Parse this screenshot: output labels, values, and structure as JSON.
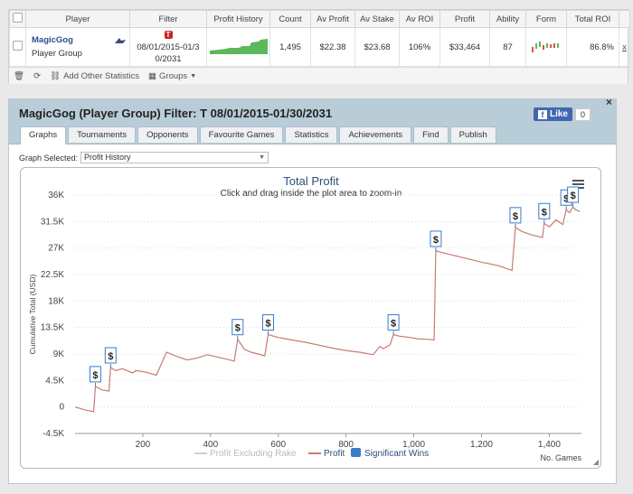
{
  "table": {
    "headers": [
      "Player",
      "Filter",
      "Profit History",
      "Count",
      "Av Profit",
      "Av Stake",
      "Av ROI",
      "Profit",
      "Ability",
      "Form",
      "Total ROI"
    ],
    "row": {
      "player_name": "MagicGog",
      "player_group": "Player Group",
      "filter_icon": "T",
      "filter_text": "08/01/2015-01/30/2031",
      "count": "1,495",
      "av_profit": "$22.38",
      "av_stake": "$23.68",
      "av_roi": "106%",
      "profit": "$33,464",
      "ability": "87",
      "total_roi": "86.8%",
      "remove": "x"
    }
  },
  "toolbar": {
    "add_stats": "Add Other Statistics",
    "groups": "Groups"
  },
  "panel": {
    "title": "MagicGog (Player Group) Filter: T 08/01/2015-01/30/2031",
    "like_label": "Like",
    "like_count": "0",
    "close": "×",
    "tabs": [
      "Graphs",
      "Tournaments",
      "Opponents",
      "Favourite Games",
      "Statistics",
      "Achievements",
      "Find",
      "Publish"
    ],
    "graph_selected_label": "Graph Selected:",
    "graph_selected_value": "Profit History"
  },
  "colors": {
    "profit_line": "#c87a72",
    "rake_line": "#d0d0d0",
    "sig_marker": "#3a7cc7",
    "title": "#2d4f7a"
  },
  "chart_data": {
    "type": "line",
    "title": "Total Profit",
    "subtitle": "Click and drag inside the plot area to zoom-in",
    "ylabel": "Cumulative Total (USD)",
    "xlabel": "No. Games",
    "ylim": [
      -4500,
      36000
    ],
    "xlim": [
      0,
      1495
    ],
    "y_ticks": [
      "-4.5K",
      "0",
      "4.5K",
      "9K",
      "13.5K",
      "18K",
      "22.5K",
      "27K",
      "31.5K",
      "36K"
    ],
    "x_ticks": [
      "200",
      "400",
      "600",
      "800",
      "1,000",
      "1,200",
      "1,400"
    ],
    "legend": [
      "Profit Excluding Rake",
      "Profit",
      "Significant Wins"
    ],
    "legend_position": "bottom",
    "series": [
      {
        "name": "Profit",
        "x": [
          0,
          30,
          55,
          60,
          80,
          100,
          105,
          120,
          140,
          170,
          180,
          210,
          240,
          270,
          300,
          330,
          360,
          390,
          420,
          450,
          470,
          480,
          500,
          520,
          540,
          560,
          570,
          600,
          640,
          680,
          720,
          760,
          800,
          840,
          880,
          900,
          910,
          930,
          940,
          960,
          990,
          1010,
          1040,
          1060,
          1065,
          1100,
          1150,
          1200,
          1250,
          1290,
          1300,
          1320,
          1350,
          1380,
          1385,
          1400,
          1420,
          1440,
          1450,
          1460,
          1470,
          1475,
          1490
        ],
        "y": [
          0,
          -500,
          -800,
          3500,
          2900,
          2700,
          6700,
          6200,
          6500,
          5800,
          6200,
          5900,
          5400,
          9300,
          8600,
          8000,
          8300,
          8900,
          8500,
          8100,
          7800,
          11500,
          9800,
          9300,
          9000,
          8700,
          12300,
          11800,
          11400,
          11000,
          10500,
          10000,
          9600,
          9300,
          8900,
          10300,
          9900,
          10600,
          12300,
          12000,
          11800,
          11600,
          11500,
          11400,
          26500,
          26000,
          25300,
          24600,
          24000,
          23200,
          30500,
          29800,
          29200,
          28800,
          31200,
          30600,
          31800,
          31000,
          33500,
          33000,
          34000,
          33600,
          33200
        ]
      }
    ],
    "significant_wins": [
      {
        "x": 60,
        "y": 3500
      },
      {
        "x": 105,
        "y": 6700
      },
      {
        "x": 480,
        "y": 11500
      },
      {
        "x": 570,
        "y": 12300
      },
      {
        "x": 940,
        "y": 12300
      },
      {
        "x": 1065,
        "y": 26500
      },
      {
        "x": 1300,
        "y": 30500
      },
      {
        "x": 1385,
        "y": 31200
      },
      {
        "x": 1450,
        "y": 33500
      },
      {
        "x": 1470,
        "y": 34000
      }
    ]
  }
}
